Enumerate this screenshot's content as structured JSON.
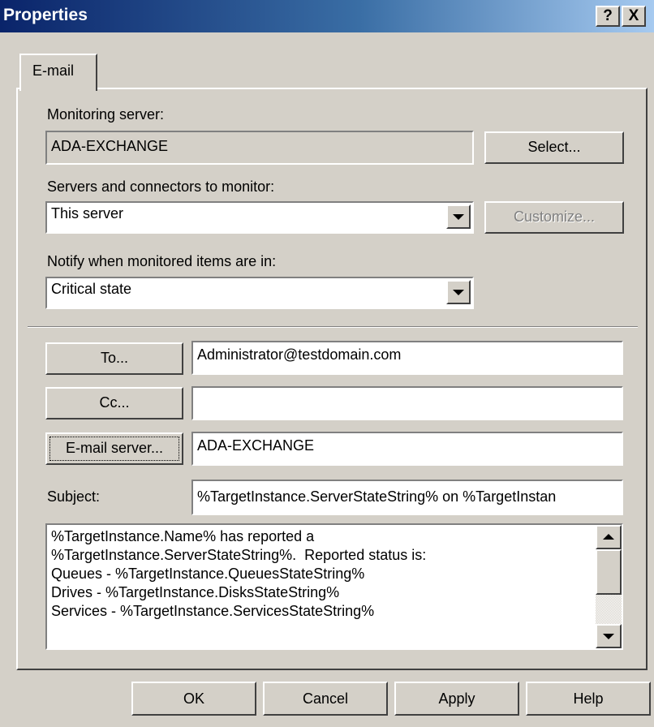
{
  "window": {
    "title": "Properties",
    "help_label": "?",
    "close_label": "X"
  },
  "tabs": [
    {
      "label": "E-mail",
      "selected": true
    }
  ],
  "monitoring_server": {
    "label": "Monitoring server:",
    "value": "ADA-EXCHANGE",
    "select_button": "Select..."
  },
  "servers_connectors": {
    "label": "Servers and connectors to monitor:",
    "value": "This server",
    "customize_button": "Customize..."
  },
  "notify": {
    "label": "Notify when monitored items are in:",
    "value": "Critical state"
  },
  "to": {
    "button": "To...",
    "value": "Administrator@testdomain.com"
  },
  "cc": {
    "button": "Cc...",
    "value": ""
  },
  "email_server": {
    "button": "E-mail server...",
    "value": "ADA-EXCHANGE"
  },
  "subject": {
    "label": "Subject:",
    "value": "%TargetInstance.ServerStateString% on %TargetInstan"
  },
  "body_text": "%TargetInstance.Name% has reported a\n%TargetInstance.ServerStateString%.  Reported status is:\nQueues - %TargetInstance.QueuesStateString%\nDrives - %TargetInstance.DisksStateString%\nServices - %TargetInstance.ServicesStateString%",
  "footer": {
    "ok": "OK",
    "cancel": "Cancel",
    "apply": "Apply",
    "help": "Help"
  }
}
